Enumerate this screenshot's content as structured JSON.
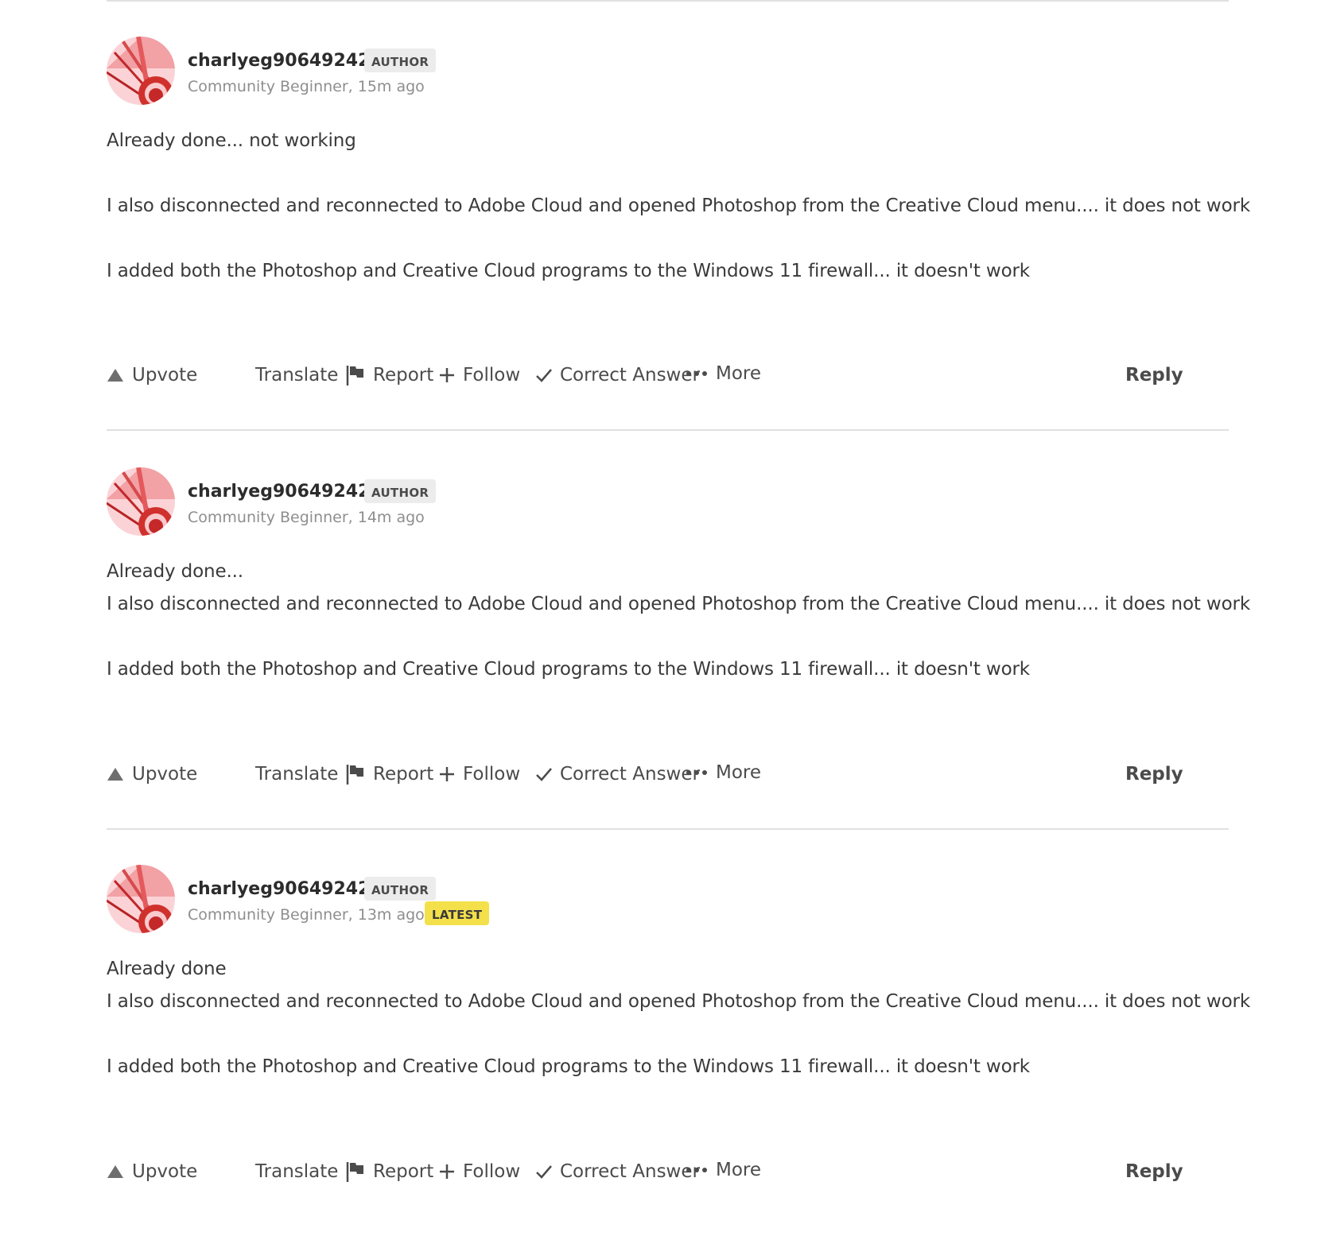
{
  "posts": [
    {
      "username": "charlyeg90649242",
      "author_badge": "AUTHOR",
      "meta": "Community Beginner, 15m ago",
      "latest_badge": "",
      "lines": [
        "Already done... not working",
        "I also disconnected and reconnected to Adobe Cloud and opened Photoshop from the Creative Cloud menu.... it does not work",
        "I added both the Photoshop and Creative Cloud programs to the Windows 11 firewall... it doesn't work"
      ]
    },
    {
      "username": "charlyeg90649242",
      "author_badge": "AUTHOR",
      "meta": "Community Beginner, 14m ago",
      "latest_badge": "",
      "lines": [
        "Already done...",
        "I also disconnected and reconnected to Adobe Cloud and opened Photoshop from the Creative Cloud menu.... it does not work",
        "I added both the Photoshop and Creative Cloud programs to the Windows 11 firewall... it doesn't work"
      ]
    },
    {
      "username": "charlyeg90649242",
      "author_badge": "AUTHOR",
      "meta": "Community Beginner, 13m ago",
      "latest_badge": "LATEST",
      "lines": [
        "Already done",
        "I also disconnected and reconnected to Adobe Cloud and opened Photoshop from the Creative Cloud menu.... it does not work",
        "I added both the Photoshop and Creative Cloud programs to the Windows 11 firewall... it doesn't work"
      ]
    }
  ],
  "actions": {
    "upvote": "Upvote",
    "translate": "Translate",
    "report": "Report",
    "follow": "Follow",
    "correct_answer": "Correct Answer",
    "more": "More",
    "reply": "Reply"
  },
  "icons": {
    "upvote": "triangle-up-icon",
    "report": "flag-icon",
    "follow": "plus-icon",
    "correct_answer": "checkmark-icon",
    "more": "ellipsis-icon"
  },
  "colors": {
    "latest_badge": "#f3e04a",
    "author_badge": "#ececec",
    "avatar_primary": "#d0312d",
    "avatar_light": "#f9c9cc"
  }
}
